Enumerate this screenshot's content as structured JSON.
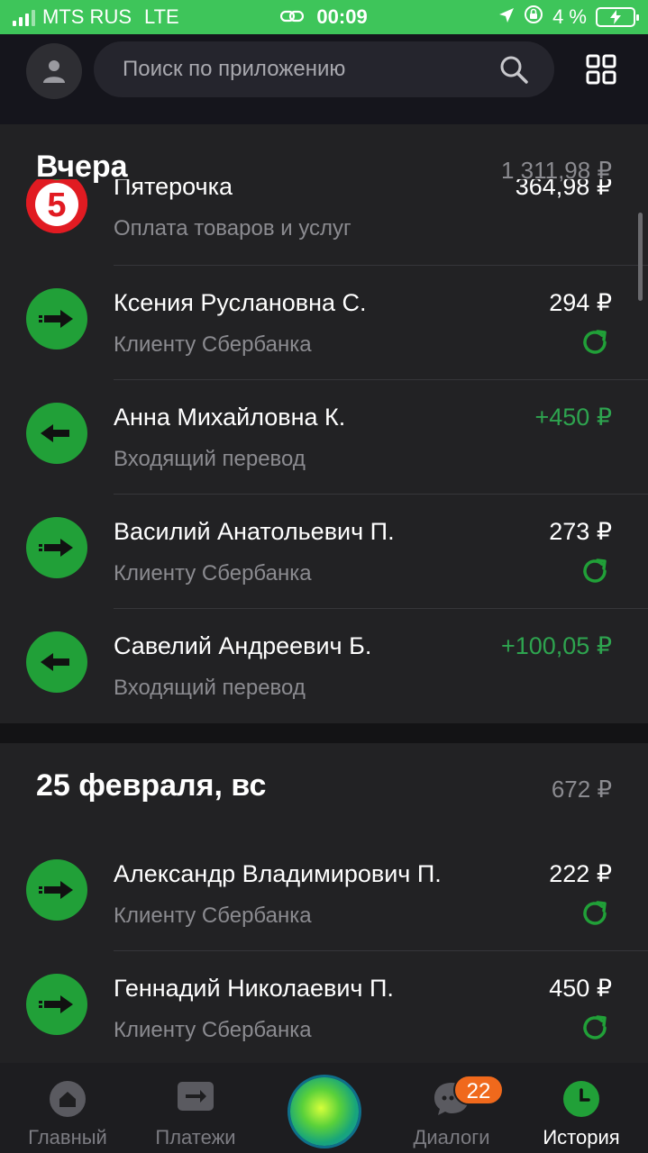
{
  "status_bar": {
    "carrier": "MTS RUS",
    "network": "LTE",
    "time": "00:09",
    "battery": "4 %"
  },
  "search": {
    "placeholder": "Поиск по приложению"
  },
  "colors": {
    "accent": "#21a038",
    "status_bar": "#3ec55a",
    "incoming_amount": "#2ea44f",
    "badge": "#f0691c"
  },
  "sections": [
    {
      "title": "Вчера",
      "total": "1 311,98 ₽",
      "transactions": [
        {
          "name": "Пятерочка",
          "subtitle": "Оплата товаров и услуг",
          "amount": "364,98 ₽",
          "icon": "pyaterochka-logo"
        },
        {
          "name": "Ксения Руслановна С.",
          "subtitle": "Клиенту Сбербанка",
          "amount": "294 ₽",
          "icon": "arrow-right-icon"
        },
        {
          "name": "Анна Михайловна К.",
          "subtitle": "Входящий перевод",
          "amount": "+450 ₽",
          "icon": "arrow-left-icon"
        },
        {
          "name": "Василий Анатольевич П.",
          "subtitle": "Клиенту Сбербанка",
          "amount": "273 ₽",
          "icon": "arrow-right-icon"
        },
        {
          "name": "Савелий Андреевич Б.",
          "subtitle": "Входящий перевод",
          "amount": "+100,05 ₽",
          "icon": "arrow-left-icon"
        }
      ]
    },
    {
      "title": "25 февраля, вс",
      "total": "672 ₽",
      "transactions": [
        {
          "name": "Александр Владимирович П.",
          "subtitle": "Клиенту Сбербанка",
          "amount": "222 ₽",
          "icon": "arrow-right-icon"
        },
        {
          "name": "Геннадий Николаевич П.",
          "subtitle": "Клиенту Сбербанка",
          "amount": "450 ₽",
          "icon": "arrow-right-icon"
        }
      ]
    }
  ],
  "bottom_nav": {
    "home": "Главный",
    "payments": "Платежи",
    "dialogs": "Диалоги",
    "dialogs_badge": "22",
    "history": "История"
  }
}
